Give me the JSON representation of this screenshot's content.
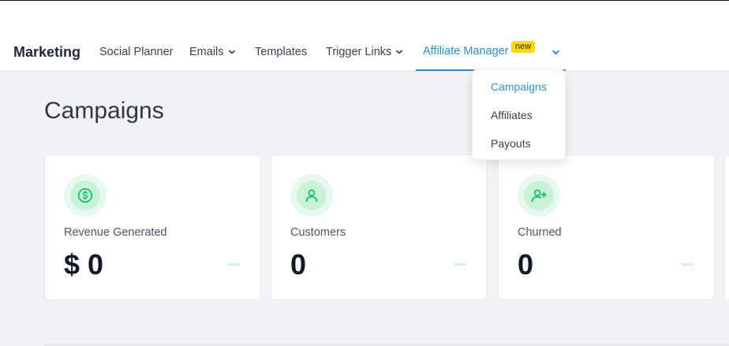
{
  "header": {
    "brand": "Marketing",
    "nav": [
      {
        "label": "Social Planner"
      },
      {
        "label": "Emails"
      },
      {
        "label": "Templates"
      },
      {
        "label": "Trigger Links"
      },
      {
        "label": "Affiliate Manager",
        "badge": "new"
      }
    ]
  },
  "dropdown": {
    "items": [
      "Campaigns",
      "Affiliates",
      "Payouts"
    ],
    "selected": "Campaigns"
  },
  "page": {
    "title": "Campaigns"
  },
  "cards": [
    {
      "label": "Revenue Generated",
      "value": "$ 0",
      "icon": "dollar-icon"
    },
    {
      "label": "Customers",
      "value": "0",
      "icon": "user-icon"
    },
    {
      "label": "Churned",
      "value": "0",
      "icon": "user-plus-icon"
    }
  ],
  "colors": {
    "accent": "#2b8fd4",
    "badge": "#f5d90a",
    "icon_green": "#16c06b"
  }
}
